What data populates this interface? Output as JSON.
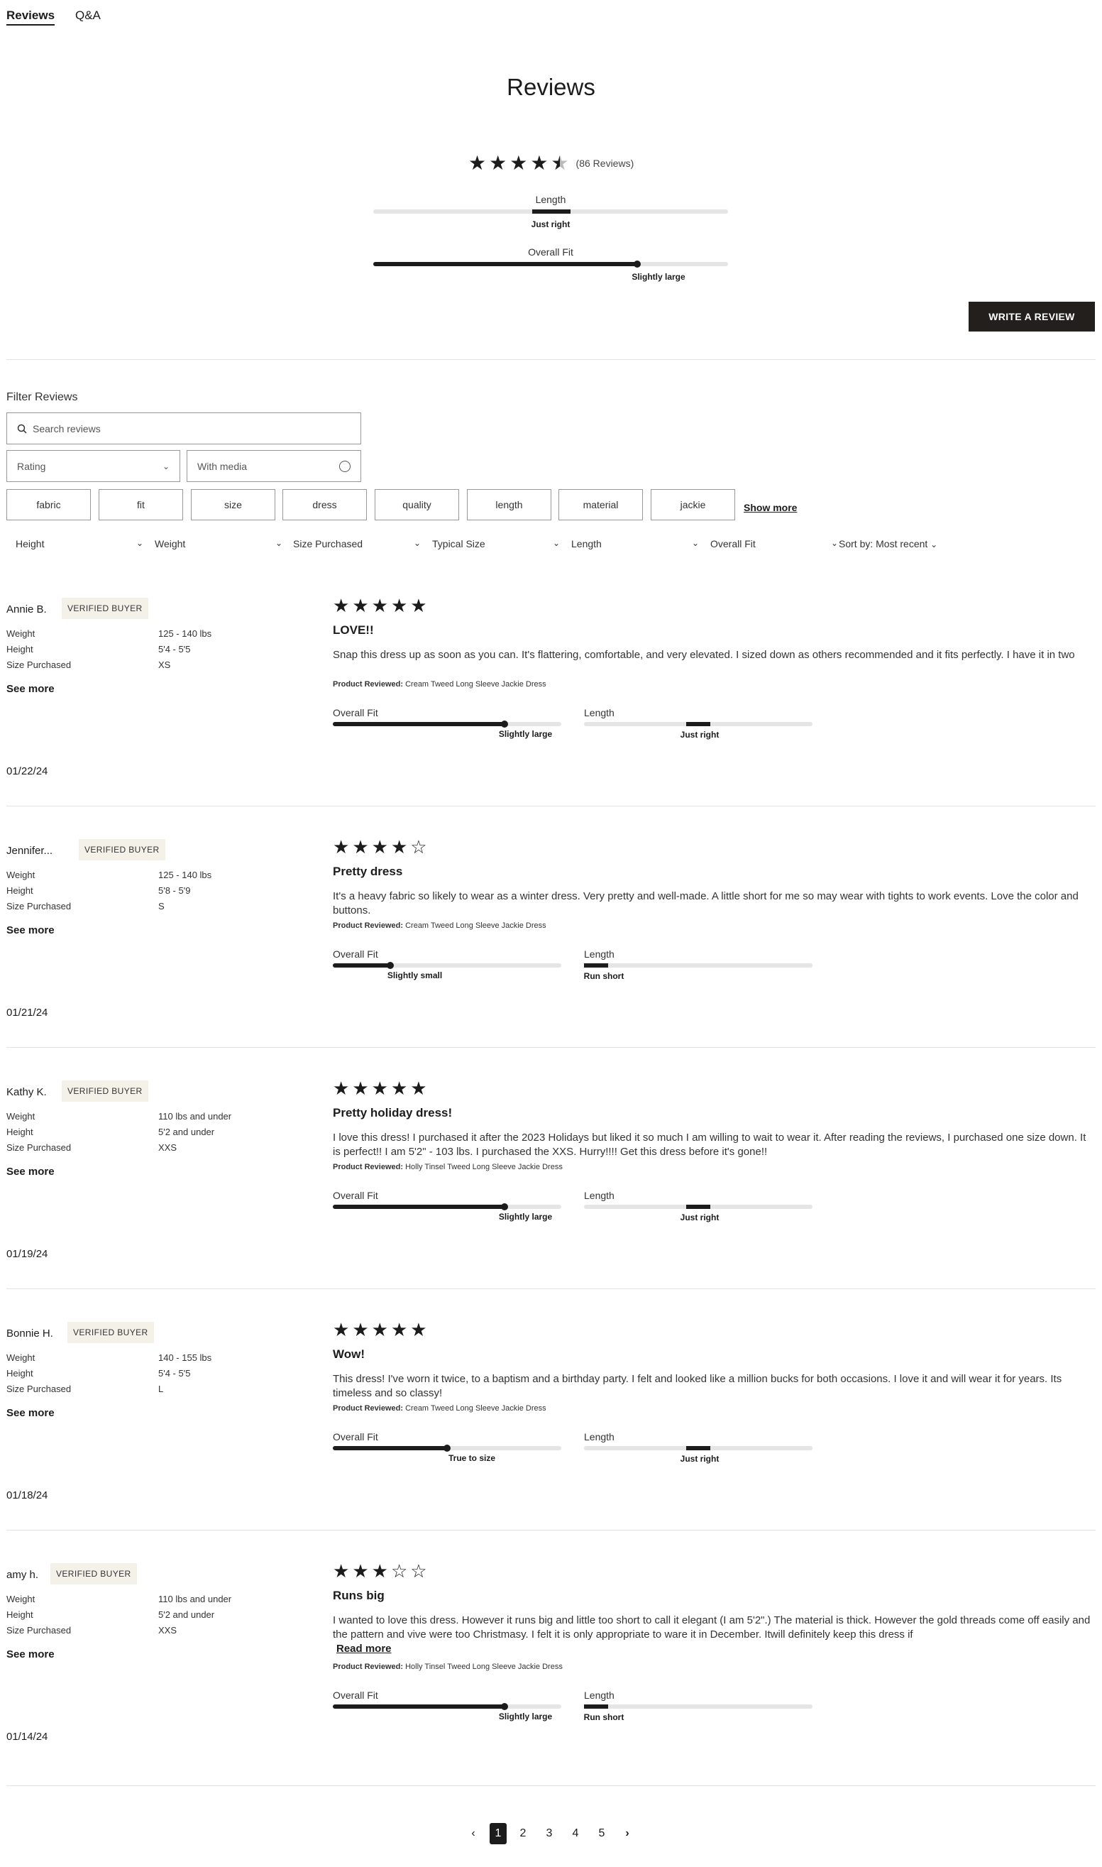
{
  "tabs": [
    {
      "label": "Reviews"
    },
    {
      "label": "Q&A"
    }
  ],
  "title": "Reviews",
  "summary": {
    "rating": 4.5,
    "count_label": "(86 Reviews)",
    "length": {
      "label": "Length",
      "caption": "Just right"
    },
    "overall_fit": {
      "label": "Overall Fit",
      "caption": "Slightly large"
    }
  },
  "write_review_label": "WRITE A REVIEW",
  "filter": {
    "title": "Filter Reviews",
    "search_placeholder": "Search reviews",
    "rating_label": "Rating",
    "with_media_label": "With media",
    "chips": [
      "fabric",
      "fit",
      "size",
      "dress",
      "quality",
      "length",
      "material",
      "jackie"
    ],
    "show_more": "Show more",
    "dropdowns": [
      "Height",
      "Weight",
      "Size Purchased",
      "Typical Size",
      "Length",
      "Overall Fit"
    ],
    "sort_label": "Sort by:",
    "sort_value": "Most recent"
  },
  "badge_label": "VERIFIED BUYER",
  "attr_labels": {
    "weight": "Weight",
    "height": "Height",
    "size": "Size Purchased"
  },
  "see_more": "See more",
  "read_more": "Read more",
  "product_prefix": "Product Reviewed:",
  "fit_label": "Overall Fit",
  "length_label": "Length",
  "reviews": [
    {
      "name": "Annie B.",
      "weight": "125 - 140 lbs",
      "height": "5'4 - 5'5",
      "size": "XS",
      "date": "01/22/24",
      "rating": 5,
      "title": "LOVE!!",
      "body": "Snap this dress up as soon as you can. It's flattering, comfortable, and very elevated. I sized down as others recommended and it fits perfectly. I have it in two",
      "product": "Cream Tweed Long Sleeve Jackie Dress",
      "fit_caption": "Slightly large",
      "fit_value": 0.75,
      "length_caption": "Just right",
      "length_value": 0.5
    },
    {
      "name": "Jennifer...",
      "weight": "125 - 140 lbs",
      "height": "5'8 - 5'9",
      "size": "S",
      "date": "01/21/24",
      "rating": 4,
      "title": "Pretty dress",
      "body": "It's a heavy fabric so likely to wear as a winter dress. Very pretty and well-made. A little short for me so may wear with tights to work events. Love the color and buttons.",
      "product": "Cream Tweed Long Sleeve Jackie Dress",
      "fit_caption": "Slightly small",
      "fit_value": 0.25,
      "length_caption": "Run short",
      "length_value": 0
    },
    {
      "name": "Kathy K.",
      "weight": "110 lbs and under",
      "height": "5'2 and under",
      "size": "XXS",
      "date": "01/19/24",
      "rating": 5,
      "title": "Pretty holiday dress!",
      "body": "I love this dress! I purchased it after the 2023 Holidays but liked it so much I am willing to wait to wear it. After reading the reviews, I purchased one size down. It is perfect!! I am 5'2\" - 103 lbs. I purchased the XXS. Hurry!!!! Get this dress before it's gone!!",
      "product": "Holly Tinsel Tweed Long Sleeve Jackie Dress",
      "fit_caption": "Slightly large",
      "fit_value": 0.75,
      "length_caption": "Just right",
      "length_value": 0.5
    },
    {
      "name": "Bonnie H.",
      "weight": "140 - 155 lbs",
      "height": "5'4 - 5'5",
      "size": "L",
      "date": "01/18/24",
      "rating": 5,
      "title": "Wow!",
      "body": "This dress! I've worn it twice, to a baptism and a birthday party. I felt and looked like a million bucks for both occasions. I love it and will wear it for years. Its timeless and so classy!",
      "product": "Cream Tweed Long Sleeve Jackie Dress",
      "fit_caption": "True to size",
      "fit_value": 0.5,
      "length_caption": "Just right",
      "length_value": 0.5
    },
    {
      "name": "amy h.",
      "weight": "110 lbs and under",
      "height": "5'2 and under",
      "size": "XXS",
      "date": "01/14/24",
      "rating": 3,
      "title": "Runs big",
      "body": "I wanted to love this dress. However it runs big and little too short to call it elegant (I am 5'2\".) The material is thick. However the gold threads come off easily and the pattern and vive were too Christmasy. I felt it is only appropriate to ware it in December. Itwill definitely keep this dress if",
      "product": "Holly Tinsel Tweed Long Sleeve Jackie Dress",
      "fit_caption": "Slightly large",
      "fit_value": 0.75,
      "length_caption": "Run short",
      "length_value": 0
    }
  ],
  "pagination": {
    "pages": [
      "1",
      "2",
      "3",
      "4",
      "5"
    ],
    "current": "1",
    "prev": "‹",
    "next": "›"
  }
}
